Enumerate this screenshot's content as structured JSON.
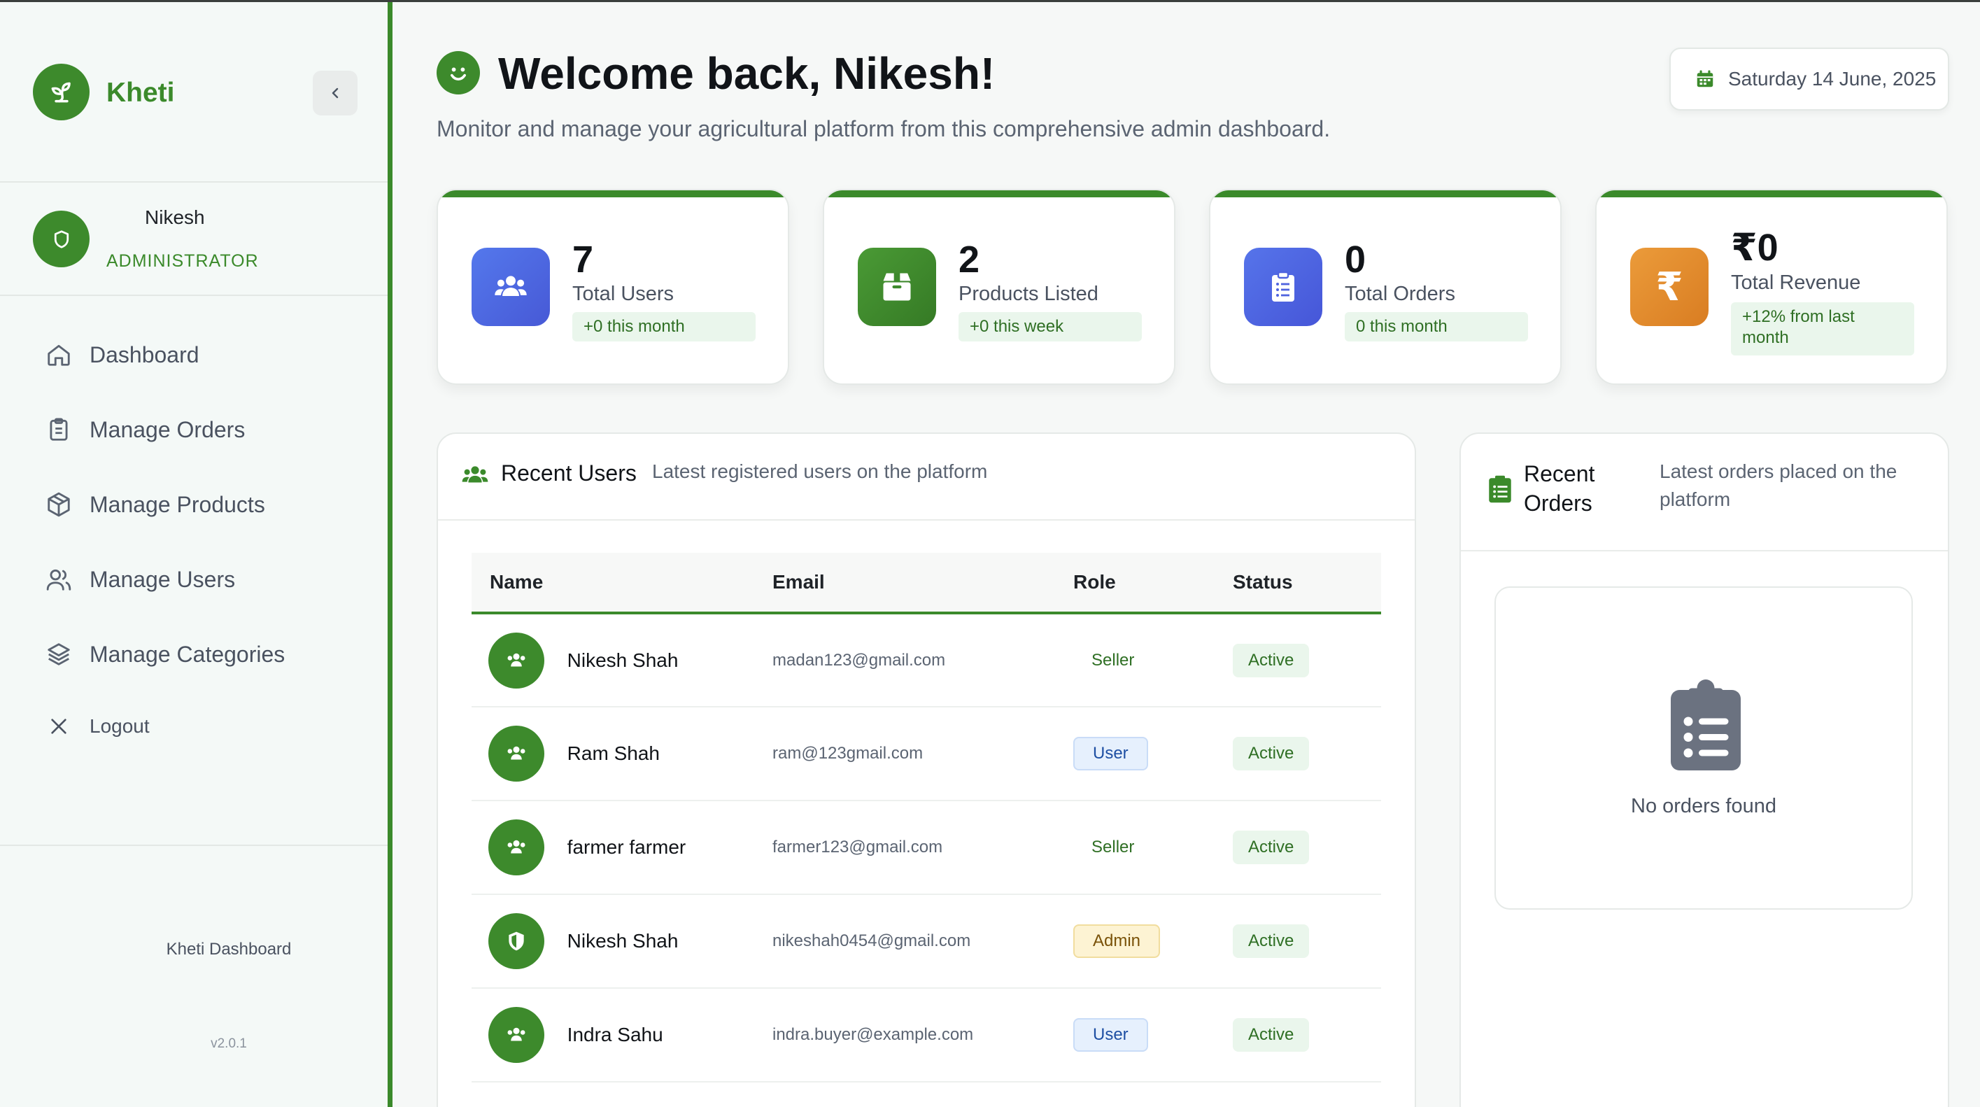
{
  "colors": {
    "brand": "#3b8a2b",
    "users_icon": "#4f6be0",
    "products_icon": "#3d8a2c",
    "orders_icon": "#4f63df",
    "revenue_icon": "#e08a2c"
  },
  "sidebar": {
    "brand": "Kheti",
    "user": {
      "name": "Nikesh",
      "role": "ADMINISTRATOR"
    },
    "items": [
      {
        "label": "Dashboard",
        "icon": "home-icon"
      },
      {
        "label": "Manage Orders",
        "icon": "clipboard-icon"
      },
      {
        "label": "Manage Products",
        "icon": "box-icon"
      },
      {
        "label": "Manage Users",
        "icon": "users-icon"
      },
      {
        "label": "Manage Categories",
        "icon": "layers-icon"
      },
      {
        "label": "Logout",
        "icon": "close-icon"
      }
    ],
    "footer_title": "Kheti Dashboard",
    "version": "v2.0.1"
  },
  "header": {
    "title": "Welcome back, Nikesh!",
    "subtitle": "Monitor and manage your agricultural platform from this comprehensive admin dashboard.",
    "date": "Saturday 14 June, 2025"
  },
  "stats": [
    {
      "value": "7",
      "label": "Total Users",
      "change": "+0 this month"
    },
    {
      "value": "2",
      "label": "Products Listed",
      "change": "+0 this week"
    },
    {
      "value": "0",
      "label": "Total Orders",
      "change": "0 this month"
    },
    {
      "value": "₹0",
      "label": "Total Revenue",
      "change": "+12% from last month"
    }
  ],
  "recent_users": {
    "title": "Recent Users",
    "subtitle": "Latest registered users on the platform",
    "columns": [
      "Name",
      "Email",
      "Role",
      "Status"
    ],
    "rows": [
      {
        "name": "Nikesh Shah",
        "email": "madan123@gmail.com",
        "role": "Seller",
        "status": "Active"
      },
      {
        "name": "Ram Shah",
        "email": "ram@123gmail.com",
        "role": "User",
        "status": "Active"
      },
      {
        "name": "farmer farmer",
        "email": "farmer123@gmail.com",
        "role": "Seller",
        "status": "Active"
      },
      {
        "name": "Nikesh Shah",
        "email": "nikeshah0454@gmail.com",
        "role": "Admin",
        "status": "Active"
      },
      {
        "name": "Indra Sahu",
        "email": "indra.buyer@example.com",
        "role": "User",
        "status": "Active"
      }
    ]
  },
  "recent_orders": {
    "title_line1": "Recent",
    "title_line2": "Orders",
    "subtitle_line1": "Latest orders placed on the",
    "subtitle_line2": "platform",
    "empty_text": "No orders found"
  }
}
